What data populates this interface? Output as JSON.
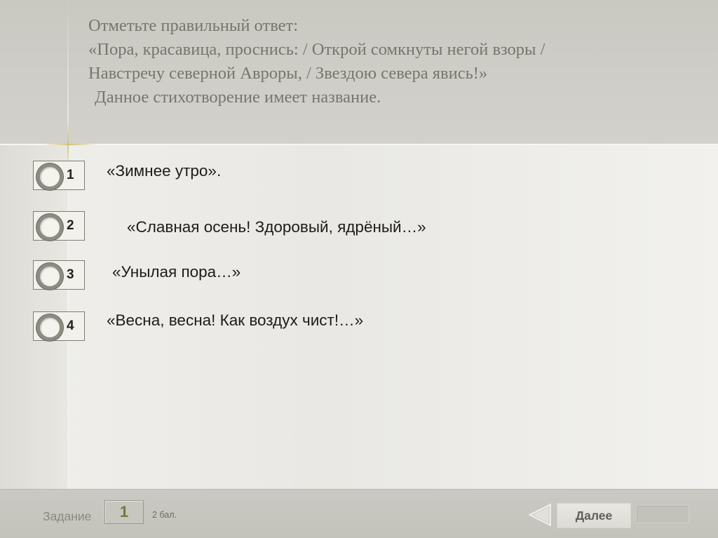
{
  "question": {
    "lines": [
      "Отметьте правильный ответ:",
      "«Пора, красавица, проснись: / Открой сомкнуты негой взоры /",
      "Навстречу северной Авроры, / Звездою севера явись!»",
      "Данное стихотворение имеет название."
    ]
  },
  "options": [
    {
      "number": "1",
      "text": "«Зимнее утро»."
    },
    {
      "number": "2",
      "text": "«Славная осень! Здоровый, ядрёный…»"
    },
    {
      "number": "3",
      "text": "«Унылая пора…»"
    },
    {
      "number": "4",
      "text": "«Весна, весна! Как воздух чист!…»"
    }
  ],
  "footer": {
    "task_label": "Задание",
    "task_number": "1",
    "points": "2 бал.",
    "next_label": "Далее",
    "back_icon": "triangle-left-icon"
  },
  "colors": {
    "header_bg": "#c9c8c1",
    "question_text": "#76766d",
    "content_bg": "#efeee9",
    "task_number": "#6e7a3a"
  }
}
